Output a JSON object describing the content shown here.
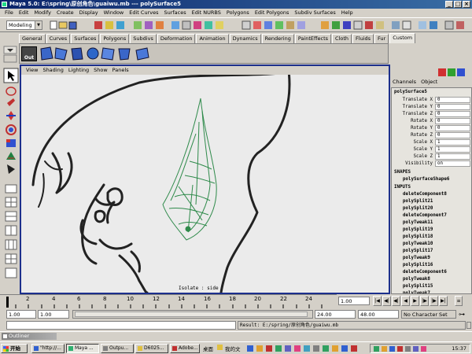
{
  "window": {
    "title": "Maya 5.0: E:\\spring\\原创角色\\guaiwu.mb  ---  polySurface5"
  },
  "menubar": [
    "File",
    "Edit",
    "Modify",
    "Create",
    "Display",
    "Window",
    "Edit Curves",
    "Surfaces",
    "Edit NURBS",
    "Polygons",
    "Edit Polygons",
    "Subdiv Surfaces",
    "Help"
  ],
  "mode_select": "Modeling",
  "shelf_tabs": [
    "General",
    "Curves",
    "Surfaces",
    "Polygons",
    "Subdivs",
    "Deformation",
    "Animation",
    "Dynamics",
    "Rendering",
    "PaintEffects",
    "Cloth",
    "Fluids",
    "Fur",
    "Custom"
  ],
  "shelf_active_tab": "Custom",
  "shelf_left_label": "Out",
  "viewport": {
    "menu": [
      "View",
      "Shading",
      "Lighting",
      "Show",
      "Panels"
    ],
    "isolate_text": "Isolate : side"
  },
  "channel_box": {
    "menu": [
      "Channels",
      "Object"
    ],
    "object_name": "polySurface5",
    "attributes": [
      {
        "label": "Translate X",
        "value": "0"
      },
      {
        "label": "Translate Y",
        "value": "0"
      },
      {
        "label": "Translate Z",
        "value": "0"
      },
      {
        "label": "Rotate X",
        "value": "0"
      },
      {
        "label": "Rotate Y",
        "value": "0"
      },
      {
        "label": "Rotate Z",
        "value": "0"
      },
      {
        "label": "Scale X",
        "value": "1"
      },
      {
        "label": "Scale Y",
        "value": "1"
      },
      {
        "label": "Scale Z",
        "value": "1"
      },
      {
        "label": "Visibility",
        "value": "on"
      }
    ],
    "shapes_header": "SHAPES",
    "shape_name": "polySurfaceShape6",
    "inputs_header": "INPUTS",
    "inputs": [
      "deleteComponent8",
      "polySplit21",
      "polySplit20",
      "deleteComponent7",
      "polyTweak11",
      "polySplit19",
      "polySplit18",
      "polyTweak10",
      "polySplit17",
      "polyTweak9",
      "polySplit16",
      "deleteComponent6",
      "polyTweak8",
      "polySplit15",
      "polyTweak7"
    ]
  },
  "timeline": {
    "ticks": [
      "2",
      "4",
      "6",
      "8",
      "10",
      "12",
      "14",
      "16",
      "18",
      "20",
      "22",
      "24"
    ],
    "current_frame": "1.00"
  },
  "range": {
    "start_time": "1.00",
    "start_range": "1.00",
    "end_range": "24.00",
    "end_time": "48.00",
    "character_set": "No Character Set"
  },
  "command": {
    "result": "Result: E:/spring/原创角色/guaiwu.mb"
  },
  "outliner_title": "Outliner",
  "taskbar": {
    "start_label": "开始",
    "tasks": [
      "\"http://...",
      "Maya ...",
      "Outpu...",
      "D6025...",
      "Adobe..."
    ],
    "desktop_label": "桌面",
    "my_docs_label": "我的文",
    "clock": "15:37"
  }
}
